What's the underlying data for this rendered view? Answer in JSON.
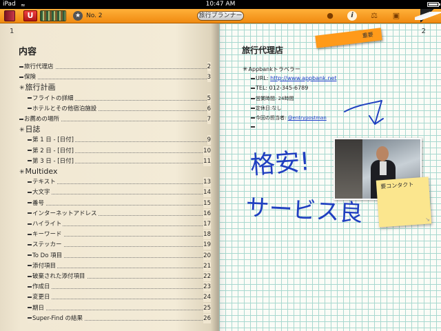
{
  "status_bar": {
    "device": "iPad",
    "time": "10:47 AM"
  },
  "toolbar": {
    "tag_glyph": "U",
    "notebook_number": "No. 2",
    "page_title": "旅行プランナー",
    "info_glyph": "i"
  },
  "left_page": {
    "page_number": "1",
    "toc_title": "内容",
    "entries": [
      {
        "label": "旅行代理店",
        "page": "2",
        "level": "sub"
      },
      {
        "label": "保険",
        "page": "3",
        "level": "sub"
      },
      {
        "label": "旅行計画",
        "page": "",
        "level": "section"
      },
      {
        "label": "フライトの詳細",
        "page": "5",
        "level": "item"
      },
      {
        "label": "ホテルとその他宿泊施設",
        "page": "6",
        "level": "item"
      },
      {
        "label": "お薦めの場所",
        "page": "7",
        "level": "sub"
      },
      {
        "label": "日誌",
        "page": "",
        "level": "section"
      },
      {
        "label": "第 1 日 - [日付]",
        "page": "9",
        "level": "item"
      },
      {
        "label": "第 2 日 - [日付]",
        "page": "10",
        "level": "item"
      },
      {
        "label": "第 3 日 - [日付]",
        "page": "11",
        "level": "item"
      },
      {
        "label": "Multidex",
        "page": "",
        "level": "section"
      },
      {
        "label": "テキスト",
        "page": "13",
        "level": "item"
      },
      {
        "label": "大文字",
        "page": "14",
        "level": "item"
      },
      {
        "label": "番号",
        "page": "15",
        "level": "item"
      },
      {
        "label": "インターネットアドレス",
        "page": "16",
        "level": "item"
      },
      {
        "label": "ハイライト",
        "page": "17",
        "level": "item"
      },
      {
        "label": "キーワード",
        "page": "18",
        "level": "item"
      },
      {
        "label": "ステッカー",
        "page": "19",
        "level": "item"
      },
      {
        "label": "To Do 項目",
        "page": "20",
        "level": "item"
      },
      {
        "label": "添付項目",
        "page": "21",
        "level": "item"
      },
      {
        "label": "破棄された添付項目",
        "page": "22",
        "level": "item"
      },
      {
        "label": "作成日",
        "page": "23",
        "level": "item"
      },
      {
        "label": "変更日",
        "page": "24",
        "level": "item"
      },
      {
        "label": "期日",
        "page": "25",
        "level": "item"
      },
      {
        "label": "Super-Find の結果",
        "page": "26",
        "level": "item"
      }
    ]
  },
  "right_page": {
    "page_number": "2",
    "tag_label": "重要",
    "heading": "旅行代理店",
    "agency_name": "Appbankトラベラー",
    "url_label": "URL: ",
    "url": "http://www.appbank.net",
    "tel": "TEL: 012-345-6789",
    "hours": "営業時間: 24時間",
    "holiday": "定休日:なし",
    "contact_label": "今回の担当者: ",
    "contact_handle": "@entrypostman",
    "sticky_note": "要コンタクト",
    "handwriting_line1": "格安!",
    "handwriting_line2": "サービス良"
  },
  "colors": {
    "toolbar": "#f39a1c",
    "ink": "#1f3fc0",
    "tag": "#ff9a19",
    "sticky": "#fbe68e"
  }
}
